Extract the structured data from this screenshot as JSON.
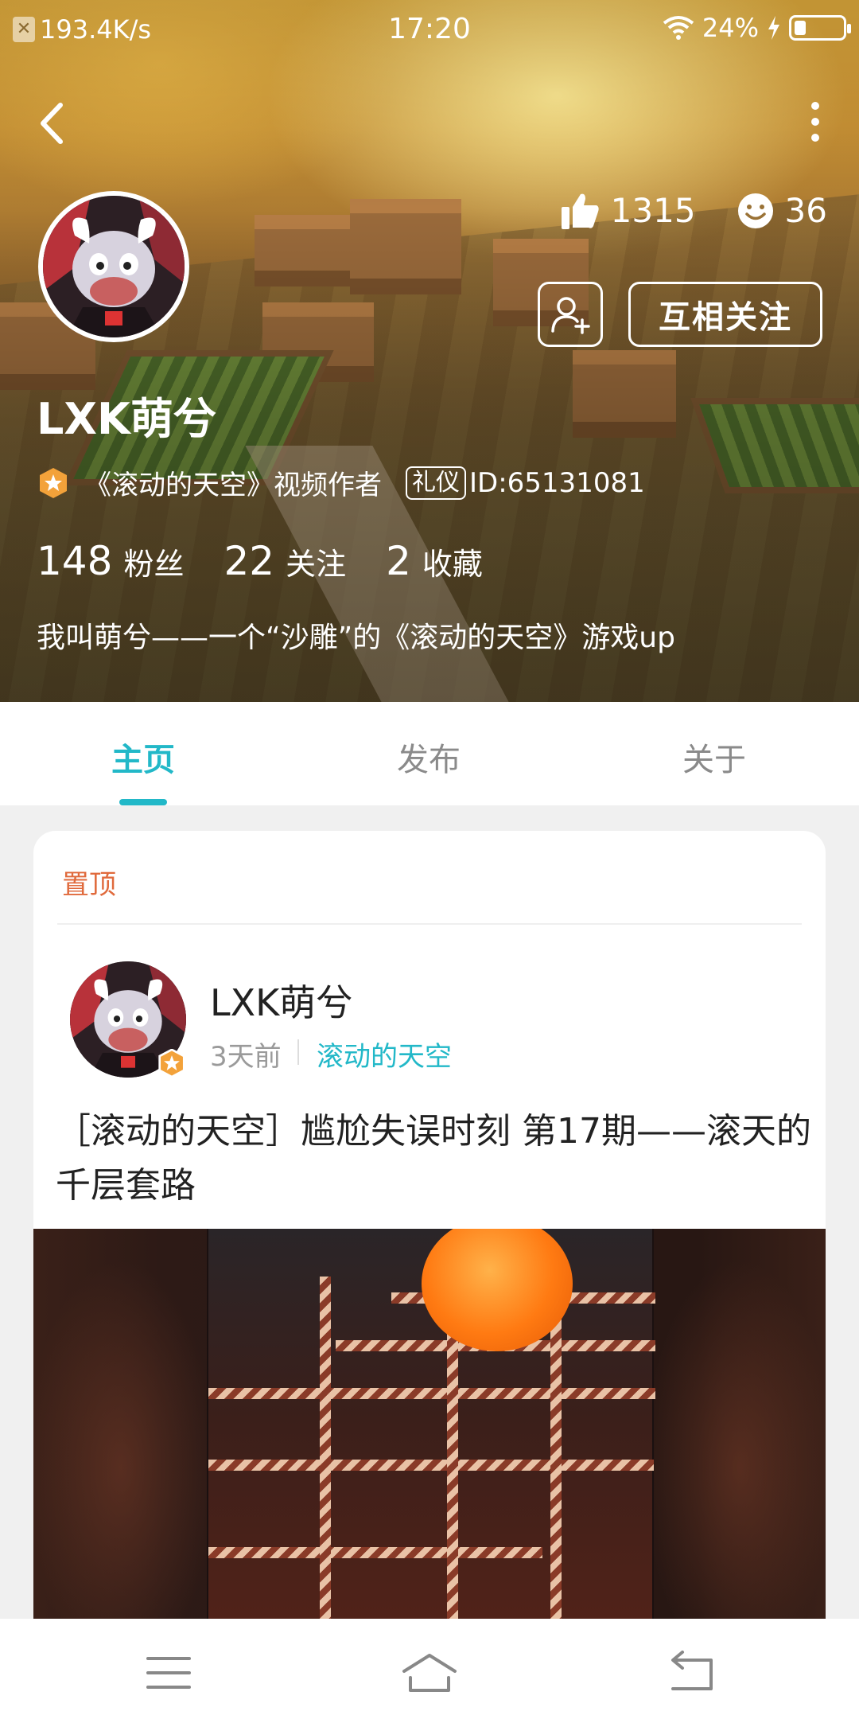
{
  "status_bar": {
    "speed": "193.4K/s",
    "time": "17:20",
    "battery_percent_text": "24%",
    "battery_level": 0.24
  },
  "profile": {
    "likes": "1315",
    "smiles": "36",
    "follow_button": "互相关注",
    "username": "LXK萌兮",
    "title": "《滚动的天空》视频作者",
    "etiquette_badge": "礼仪",
    "id_text": "ID:65131081",
    "fans_count": "148",
    "fans_label": "粉丝",
    "following_count": "22",
    "following_label": "关注",
    "favorites_count": "2",
    "favorites_label": "收藏",
    "bio": "我叫萌兮——一个“沙雕”的《滚动的天空》游戏up"
  },
  "tabs": [
    {
      "label": "主页",
      "active": true
    },
    {
      "label": "发布",
      "active": false
    },
    {
      "label": "关于",
      "active": false
    }
  ],
  "post": {
    "pinned_label": "置顶",
    "author": "LXK萌兮",
    "time": "3天前",
    "game": "滚动的天空",
    "title": "［滚动的天空］尴尬失误时刻 第17期——滚天的千层套路"
  },
  "colors": {
    "accent": "#22b8c8",
    "pinned": "#e06a3c"
  },
  "icons": {
    "back": "chevron-left-icon",
    "more": "vertical-dots-icon",
    "like": "thumbs-up-icon",
    "smile": "smiley-icon",
    "add_friend": "add-user-icon",
    "menu": "hamburger-icon",
    "home": "home-icon",
    "return": "back-arrow-icon"
  }
}
